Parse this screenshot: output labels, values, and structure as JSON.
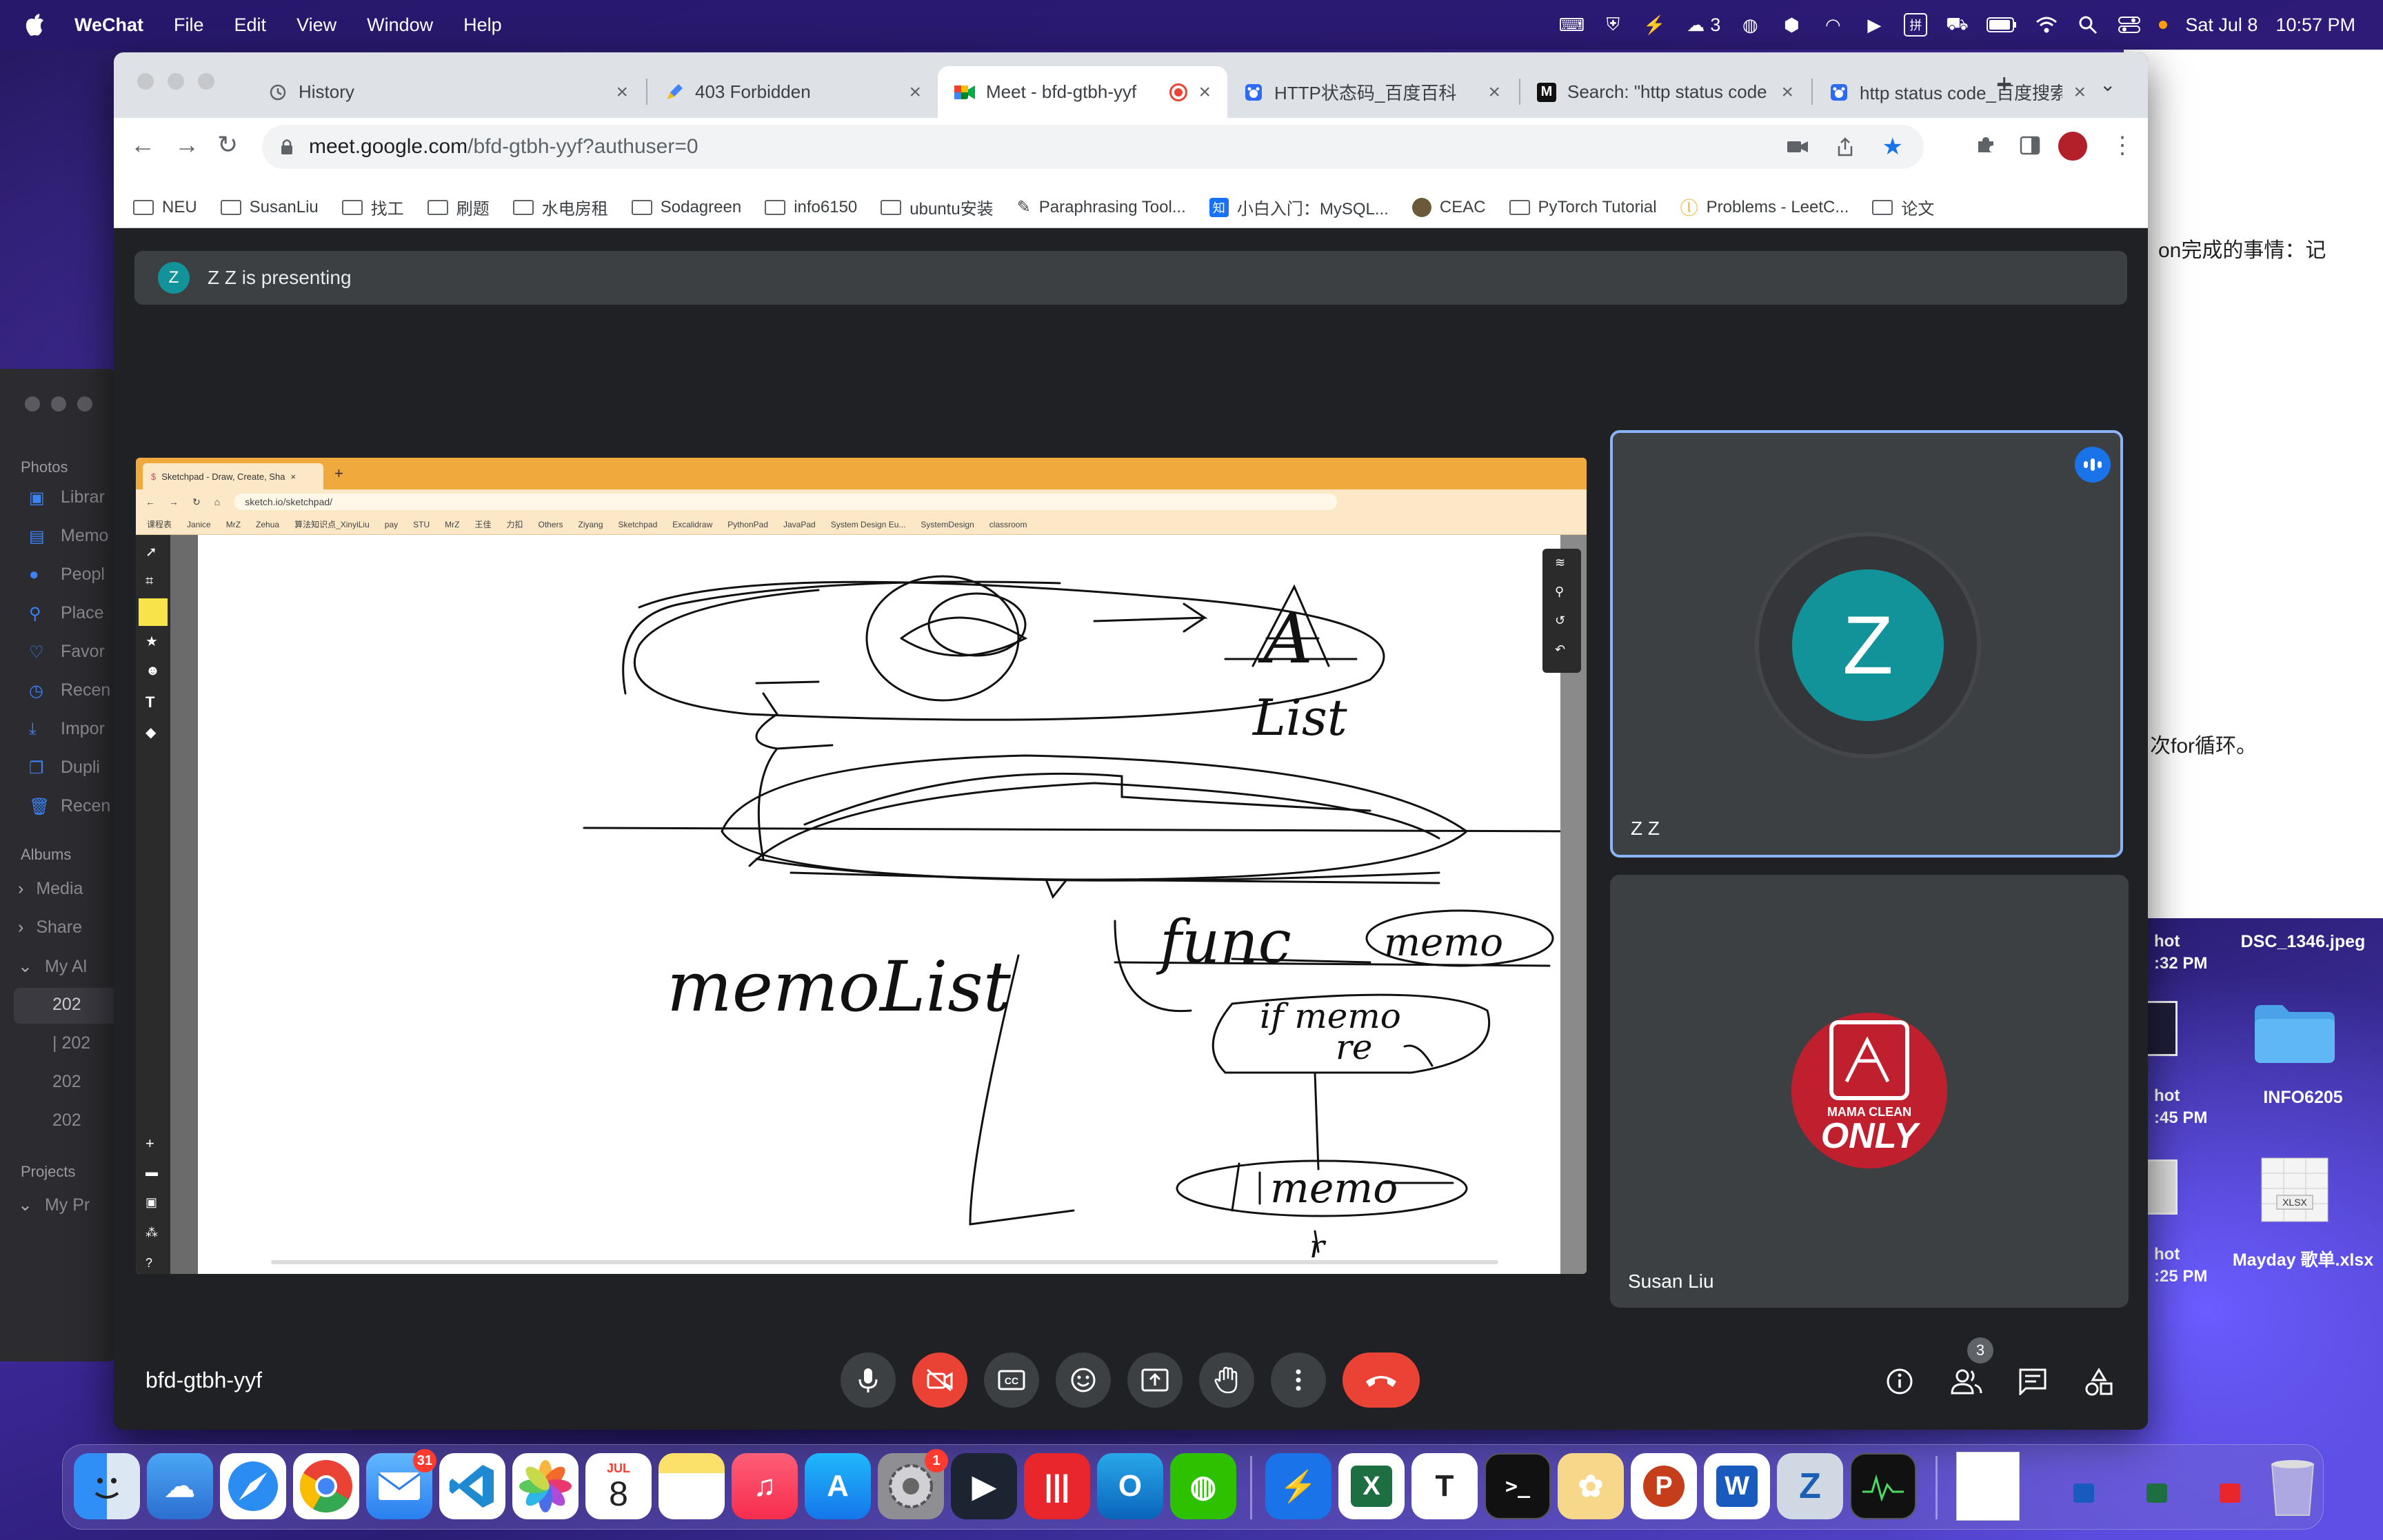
{
  "menubar": {
    "app": "WeChat",
    "menus": [
      "File",
      "Edit",
      "View",
      "Window",
      "Help"
    ],
    "status_count": "3",
    "date": "Sat Jul 8",
    "time": "10:57 PM"
  },
  "background_doc": {
    "line1": "on完成的事情：记",
    "line2": "次for循环。"
  },
  "photos_sidebar": {
    "section1": "Photos",
    "items": [
      "Librar",
      "Memo",
      "Peopl",
      "Place",
      "Favor",
      "Recen",
      "Impor",
      "Dupli",
      "Recen"
    ],
    "section2": "Albums",
    "albums": [
      "Media",
      "Share",
      "My Al"
    ],
    "sub": [
      "202",
      "| 202",
      "202",
      "202"
    ],
    "section3": "Projects",
    "projects": [
      "My Pr"
    ]
  },
  "desktop_files": [
    {
      "label": "DSC_1346.jpeg"
    },
    {
      "label": "INFO6205"
    },
    {
      "label": "Mayday 歌单.xlsx"
    }
  ],
  "desktop_partial": [
    "hot",
    ":32 PM",
    "hot",
    ":45 PM",
    "hot",
    ":25 PM"
  ],
  "tabs": [
    {
      "title": "History",
      "active": false
    },
    {
      "title": "403 Forbidden",
      "active": false
    },
    {
      "title": "Meet - bfd-gtbh-yyf",
      "active": true
    },
    {
      "title": "HTTP状态码_百度百科",
      "active": false
    },
    {
      "title": "Search: \"http status code",
      "active": false
    },
    {
      "title": "http status code_百度搜索",
      "active": false
    }
  ],
  "address": {
    "host": "meet.google.com",
    "path": "/bfd-gtbh-yyf?authuser=0"
  },
  "bookmarks": [
    "NEU",
    "SusanLiu",
    "找工",
    "刷题",
    "水电房租",
    "Sodagreen",
    "info6150",
    "ubuntu安装",
    "Paraphrasing Tool...",
    "小白入门：MySQL...",
    "CEAC",
    "PyTorch Tutorial",
    "Problems - LeetC...",
    "论文"
  ],
  "meet": {
    "presenting_initial": "Z",
    "presenting_text": "Z Z is presenting",
    "tile1": {
      "initial": "Z",
      "name": "Z Z"
    },
    "tile2": {
      "name": "Susan Liu",
      "avatar_text1": "MAMA CLEAN",
      "avatar_text2": "ONLY"
    },
    "meeting_code": "bfd-gtbh-yyf",
    "people_count": "3"
  },
  "shared_screen": {
    "tab_title": "Sketchpad - Draw, Create, Sha",
    "url": "sketch.io/sketchpad/",
    "bookmarks": [
      "课程表",
      "Janice",
      "MrZ",
      "Zehua",
      "算法知识点_XinyiLiu",
      "pay",
      "STU",
      "MrZ",
      "王佳",
      "力扣",
      "Others",
      "Ziyang",
      "Sketchpad",
      "Excalidraw",
      "PythonPad",
      "JavaPad",
      "System Design Eu...",
      "SystemDesign",
      "classroom"
    ],
    "drawing_text": [
      "A",
      "List",
      "memoList",
      "func",
      "memo",
      "if memo",
      "re",
      "memo",
      "r"
    ]
  },
  "dock": {
    "mail_badge": "31",
    "calendar_month": "JUL",
    "calendar_day": "8",
    "settings_badge": "1"
  }
}
